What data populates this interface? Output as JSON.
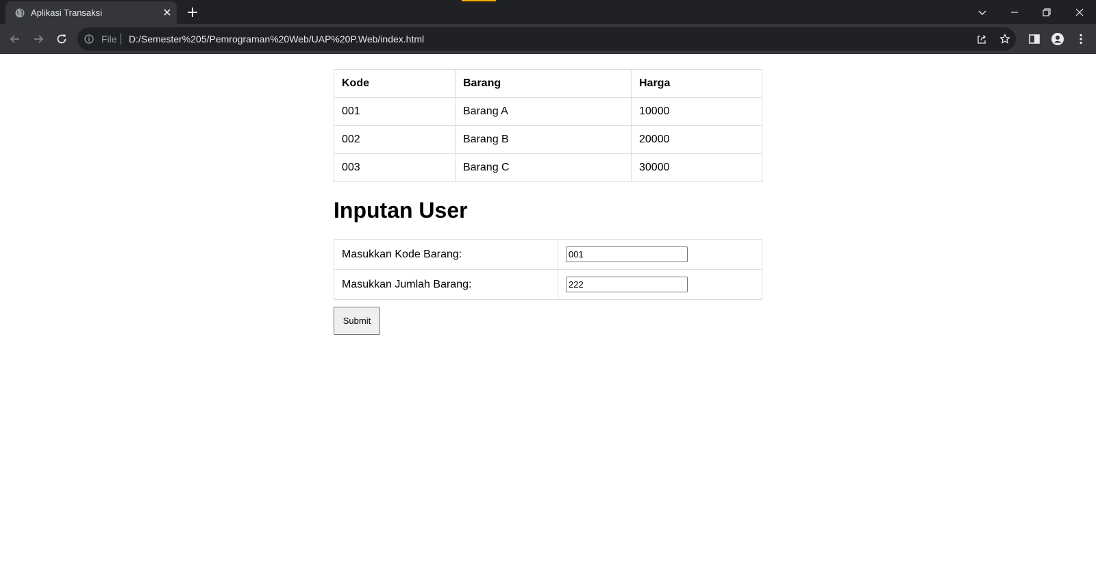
{
  "browser": {
    "tab_title": "Aplikasi Transaksi",
    "omnibox_scheme": "File",
    "url": "D:/Semester%205/Pemrograman%20Web/UAP%20P.Web/index.html"
  },
  "product_table": {
    "headers": [
      "Kode",
      "Barang",
      "Harga"
    ],
    "rows": [
      [
        "001",
        "Barang A",
        "10000"
      ],
      [
        "002",
        "Barang B",
        "20000"
      ],
      [
        "003",
        "Barang C",
        "30000"
      ]
    ]
  },
  "form": {
    "heading": "Inputan User",
    "kode_label": "Masukkan Kode Barang:",
    "kode_value": "001",
    "jumlah_label": "Masukkan Jumlah Barang:",
    "jumlah_value": "222",
    "submit_label": "Submit"
  },
  "colors": {
    "titlebar": "#202124",
    "toolbar": "#35363a",
    "accent": "#f9ab00"
  }
}
